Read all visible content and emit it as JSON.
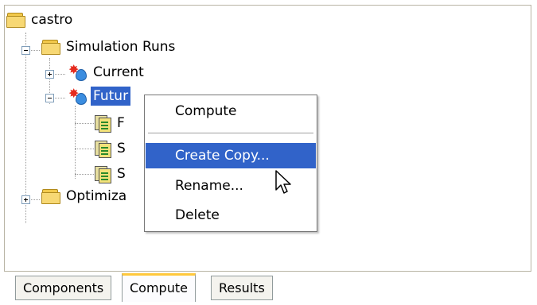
{
  "tree": {
    "root": {
      "label": "castro",
      "icon": "folder-icon"
    },
    "simulation_runs": {
      "label": "Simulation Runs",
      "expanded": true
    },
    "current": {
      "label": "Current",
      "expanded": false
    },
    "future": {
      "label": "Futur",
      "expanded": true,
      "selected": true
    },
    "children": [
      {
        "label": "F"
      },
      {
        "label": "S"
      },
      {
        "label": "S"
      }
    ],
    "optimization": {
      "label": "Optimiza",
      "expanded": false
    }
  },
  "context_menu": {
    "items": [
      {
        "label": "Compute",
        "highlighted": false
      },
      {
        "label": "Create Copy...",
        "highlighted": true
      },
      {
        "label": "Rename...",
        "highlighted": false
      },
      {
        "label": "Delete",
        "highlighted": false
      }
    ]
  },
  "tabs": [
    {
      "label": "Components",
      "active": false
    },
    {
      "label": "Compute",
      "active": true
    },
    {
      "label": "Results",
      "active": false
    }
  ],
  "colors": {
    "selection": "#3163c9",
    "active_tab_accent": "#ffc83c"
  }
}
